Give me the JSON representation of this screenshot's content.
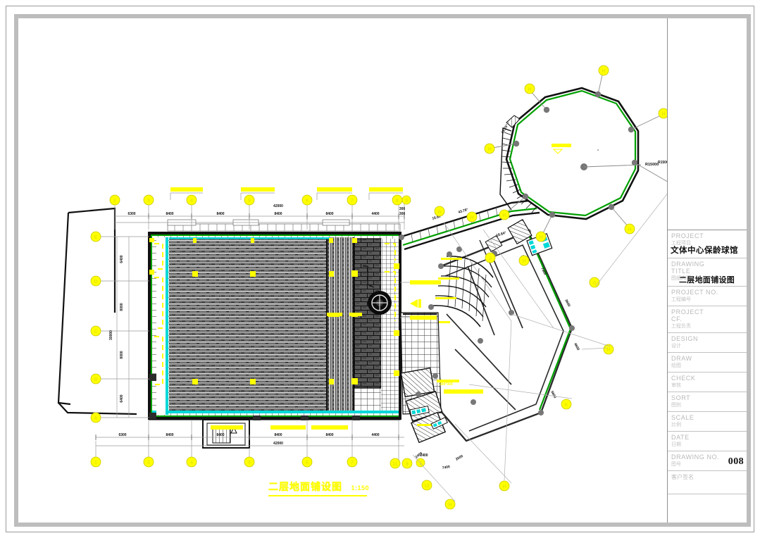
{
  "sheet": {
    "border_color": "#bdbdbd",
    "background": "#ffffff"
  },
  "title_block": {
    "rows": [
      {
        "key": "project",
        "en": "PROJECT",
        "cn": "工程项目",
        "value": "文体中心保龄球馆"
      },
      {
        "key": "drawing_title",
        "en": "DRAWING\nTITLE",
        "cn": "图纸内容",
        "value": "二层地面铺设图"
      },
      {
        "key": "project_no",
        "en": "PROJECT  NO.",
        "cn": "工程编号",
        "value": ""
      },
      {
        "key": "project_cf",
        "en": "PROJECT\nCF.",
        "cn": "工程负责",
        "value": ""
      },
      {
        "key": "design",
        "en": "DESIGN",
        "cn": "设计",
        "value": ""
      },
      {
        "key": "draw",
        "en": "DRAW",
        "cn": "绘图",
        "value": ""
      },
      {
        "key": "check",
        "en": "CHECK",
        "cn": "审核",
        "value": ""
      },
      {
        "key": "sort",
        "en": "SORT",
        "cn": "图别",
        "value": ""
      },
      {
        "key": "scale",
        "en": "SCALE",
        "cn": "比例",
        "value": ""
      },
      {
        "key": "date",
        "en": "DATE",
        "cn": "日期",
        "value": ""
      },
      {
        "key": "drawing_no",
        "en": "DRAWING  NO.",
        "cn": "图号",
        "value": "008"
      }
    ],
    "signature_label": "客户签名"
  },
  "plan": {
    "title": "二层地面铺设图",
    "scale": "1:150",
    "accent_yellow": "#ffff00",
    "accent_green": "#00a000",
    "accent_cyan": "#00d8d8",
    "line_color": "#1a1a1a"
  },
  "grid_bubbles": {
    "top": [
      "2",
      "3",
      "4",
      "5",
      "6",
      "7",
      "8",
      "9"
    ],
    "bottom": [
      "1",
      "3",
      "4",
      "5",
      "6",
      "7",
      "11",
      "8",
      "12"
    ],
    "left": [
      "E",
      "D",
      "C",
      "B",
      "A"
    ],
    "radial": [
      "H",
      "H",
      "H",
      "H",
      "H",
      "H",
      "H",
      "H",
      "G",
      "J",
      "K"
    ]
  },
  "dimensions": {
    "top_chain": [
      "6300",
      "8400",
      "8400",
      "8400",
      "8400",
      "4400",
      "300",
      "300"
    ],
    "top_overall": "42000",
    "bottom_chain": [
      "6300",
      "8400",
      "8400",
      "8400",
      "8400",
      "4400",
      "2400"
    ],
    "bottom_overall": "42000",
    "left_chain": [
      "6400",
      "8000",
      "8000",
      "6400"
    ],
    "left_overall": "30000",
    "angled": [
      "16.80°",
      "43.78°",
      "18.84°",
      "14.52°",
      "7400",
      "2400",
      "3600",
      "4600",
      "5600"
    ],
    "radius_label": "R15000",
    "elevation_label": "8.400"
  },
  "annotations": {
    "tile_callouts": [
      "600*600",
      "600*600",
      "600*600",
      "600*600",
      "600*600",
      "300*300"
    ],
    "floor_patterns": [
      "木地板保龄球道",
      "防滑地砖",
      "水磨石",
      "地毯"
    ]
  },
  "icons": {
    "north_arrow": "north-arrow-icon",
    "elevation_marker": "elevation-marker-icon"
  }
}
